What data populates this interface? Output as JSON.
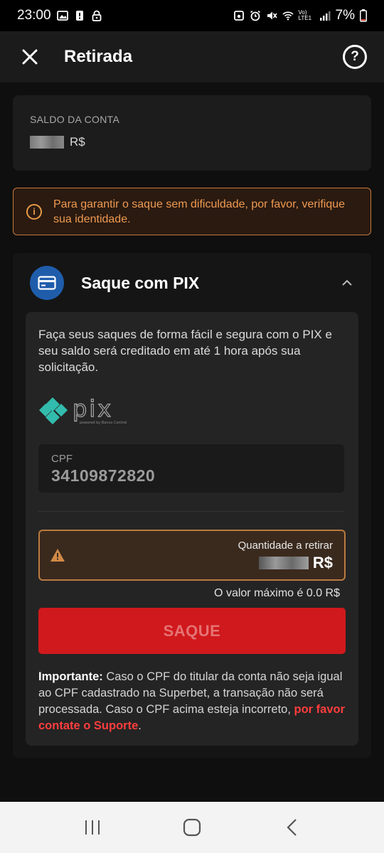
{
  "status_bar": {
    "time": "23:00",
    "battery": "7%",
    "lte_label": "Vo) LTE1"
  },
  "header": {
    "title": "Retirada",
    "help_symbol": "?"
  },
  "balance": {
    "label": "SALDO DA CONTA",
    "currency": "R$"
  },
  "warning": {
    "icon": "info-icon",
    "text": "Para garantir o saque sem dificuldade, por favor, verifique sua identidade."
  },
  "pix": {
    "title": "Saque com PIX",
    "description": "Faça seus saques de forma fácil e segura com o PIX e seu saldo será creditado em até 1 hora após sua solicitação.",
    "logo_text": "pix",
    "logo_sub": "powered by Banco Central",
    "cpf": {
      "label": "CPF",
      "value": "34109872820"
    },
    "amount": {
      "label": "Quantidade a retirar",
      "currency": "R$"
    },
    "max_note": "O valor máximo é 0.0 R$",
    "button_label": "SAQUE",
    "important_label": "Importante:",
    "important_text": " Caso o CPF do titular da conta não seja igual ao CPF cadastrado na Superbet, a transação não será processada. Caso o CPF acima esteja incorreto, ",
    "support_link": "por favor contate o Suporte",
    "important_end": "."
  },
  "colors": {
    "accent_red": "#d0191c",
    "warning_orange": "#c9773a",
    "pix_blue": "#1f5dab",
    "pix_teal": "#32bcad"
  }
}
